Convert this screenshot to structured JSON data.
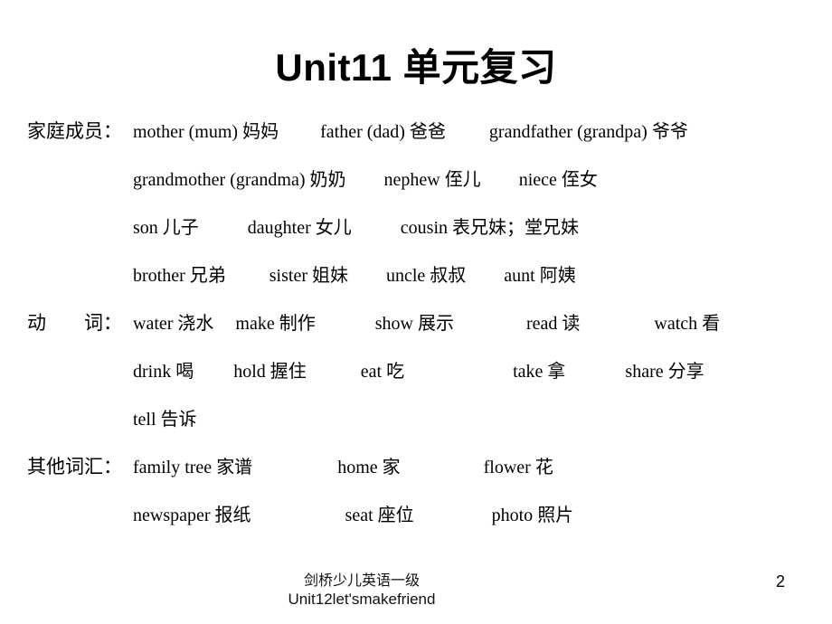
{
  "slide": {
    "title": "Unit11 单元复习",
    "page_number": "2",
    "background_color": "#ffffff",
    "text_color": "#000000"
  },
  "sections": [
    {
      "label": "家庭成员：",
      "rows": [
        [
          {
            "en": "mother (mum)",
            "cn": "妈妈",
            "gap": 46
          },
          {
            "en": "father (dad)",
            "cn": "爸爸",
            "gap": 48
          },
          {
            "en": "grandfather (grandpa)",
            "cn": "爷爷",
            "gap": 0
          }
        ],
        [
          {
            "en": "grandmother (grandma)",
            "cn": "奶奶",
            "gap": 42
          },
          {
            "en": "nephew",
            "cn": "侄儿",
            "gap": 42
          },
          {
            "en": "niece",
            "cn": "侄女",
            "gap": 0
          }
        ],
        [
          {
            "en": "son",
            "cn": "儿子",
            "gap": 54
          },
          {
            "en": "daughter",
            "cn": "女儿",
            "gap": 54
          },
          {
            "en": "cousin",
            "cn": "表兄妹；堂兄妹",
            "gap": 0
          }
        ],
        [
          {
            "en": "brother",
            "cn": "兄弟",
            "gap": 48
          },
          {
            "en": "sister",
            "cn": "姐妹",
            "gap": 42
          },
          {
            "en": "uncle",
            "cn": "叔叔",
            "gap": 42
          },
          {
            "en": "aunt",
            "cn": "阿姨",
            "gap": 0
          }
        ]
      ]
    },
    {
      "label": "动　　词：",
      "rows": [
        [
          {
            "en": "water",
            "cn": "浇水",
            "gap": 24
          },
          {
            "en": "make",
            "cn": "制作",
            "gap": 66
          },
          {
            "en": "show",
            "cn": "展示",
            "gap": 80
          },
          {
            "en": "read",
            "cn": "读",
            "gap": 82
          },
          {
            "en": "watch",
            "cn": "看",
            "gap": 0
          }
        ],
        [
          {
            "en": "drink",
            "cn": "喝",
            "gap": 44
          },
          {
            "en": "hold",
            "cn": "握住",
            "gap": 60
          },
          {
            "en": "eat",
            "cn": "吃",
            "gap": 120
          },
          {
            "en": "take",
            "cn": "拿",
            "gap": 66
          },
          {
            "en": "share",
            "cn": "分享",
            "gap": 0
          }
        ],
        [
          {
            "en": "tell",
            "cn": "告诉",
            "gap": 0
          }
        ]
      ]
    },
    {
      "label": "其他词汇：",
      "rows": [
        [
          {
            "en": "family tree",
            "cn": "家谱",
            "gap": 94
          },
          {
            "en": "home",
            "cn": "家",
            "gap": 92
          },
          {
            "en": "flower",
            "cn": "花",
            "gap": 0
          }
        ],
        [
          {
            "en": "newspaper",
            "cn": "报纸",
            "gap": 104
          },
          {
            "en": "seat",
            "cn": "座位",
            "gap": 86
          },
          {
            "en": "photo",
            "cn": "照片",
            "gap": 0
          }
        ]
      ]
    }
  ],
  "footer": {
    "line1": "剑桥少儿英语一级",
    "line2": "Unit12let'smakefriend"
  }
}
